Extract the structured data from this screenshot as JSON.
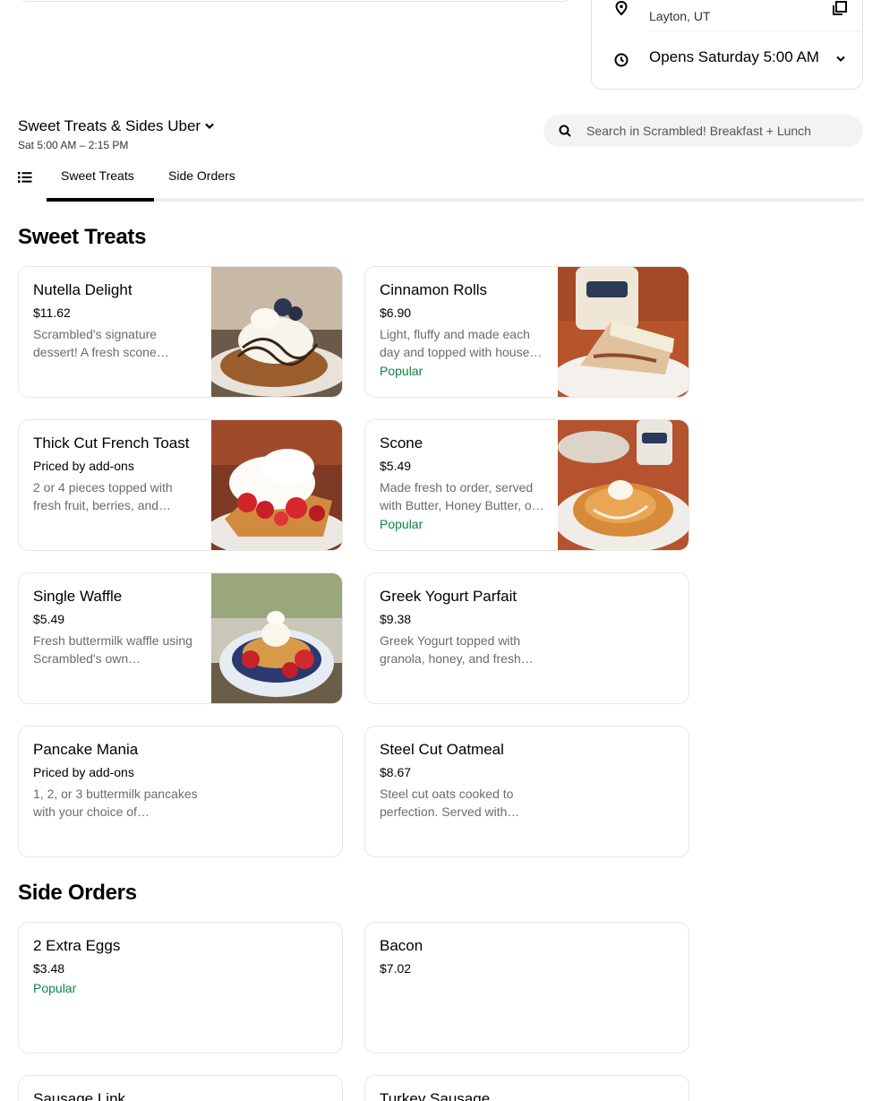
{
  "store": {
    "location": "Layton, UT",
    "hours_status": "Opens Saturday 5:00 AM"
  },
  "menu": {
    "title": "Sweet Treats & Sides Uber",
    "hours": "Sat 5:00 AM – 2:15 PM"
  },
  "search": {
    "placeholder": "Search in Scrambled! Breakfast + Lunch"
  },
  "tabs": [
    {
      "label": "Sweet Treats",
      "active": true
    },
    {
      "label": "Side Orders",
      "active": false
    }
  ],
  "sections": [
    {
      "title": "Sweet Treats",
      "items": [
        {
          "name": "Nutella Delight",
          "price": "$11.62",
          "desc": "Scrambled's signature dessert! A fresh scone…",
          "badge": "",
          "photo": "nutella-scone"
        },
        {
          "name": "Cinnamon Rolls",
          "price": "$6.90",
          "desc": "Light, fluffy and made each day and topped with house…",
          "badge": "Popular",
          "photo": "cinnamon-roll"
        },
        {
          "name": "Thick Cut French Toast",
          "price": "Priced by add-ons",
          "desc": "2 or 4 pieces topped with fresh fruit, berries, and…",
          "badge": "",
          "photo": "french-toast"
        },
        {
          "name": "Scone",
          "price": "$5.49",
          "desc": "Made fresh to order, served with Butter, Honey Butter, o…",
          "badge": "Popular",
          "photo": "scone"
        },
        {
          "name": "Single Waffle",
          "price": "$5.49",
          "desc": "Fresh buttermilk waffle using Scrambled's own…",
          "badge": "",
          "photo": "waffle"
        },
        {
          "name": "Greek Yogurt Parfait",
          "price": "$9.38",
          "desc": "Greek Yogurt topped with granola, honey, and fresh…",
          "badge": "",
          "photo": ""
        },
        {
          "name": "Pancake Mania",
          "price": "Priced by add-ons",
          "desc": "1, 2, or 3 buttermilk pancakes with your choice of…",
          "badge": "",
          "photo": ""
        },
        {
          "name": "Steel Cut Oatmeal",
          "price": "$8.67",
          "desc": "Steel cut oats cooked to perfection. Served with…",
          "badge": "",
          "photo": ""
        }
      ]
    },
    {
      "title": "Side Orders",
      "items": [
        {
          "name": "2 Extra Eggs",
          "price": "$3.48",
          "desc": "",
          "badge": "Popular",
          "photo": ""
        },
        {
          "name": "Bacon",
          "price": "$7.02",
          "desc": "",
          "badge": "",
          "photo": ""
        },
        {
          "name": "Sausage Link",
          "price": "",
          "desc": "",
          "badge": "",
          "photo": ""
        },
        {
          "name": "Turkey Sausage",
          "price": "",
          "desc": "",
          "badge": "",
          "photo": ""
        }
      ]
    }
  ],
  "colors": {
    "popular": "#0e8345",
    "border": "#e8e8e8"
  }
}
